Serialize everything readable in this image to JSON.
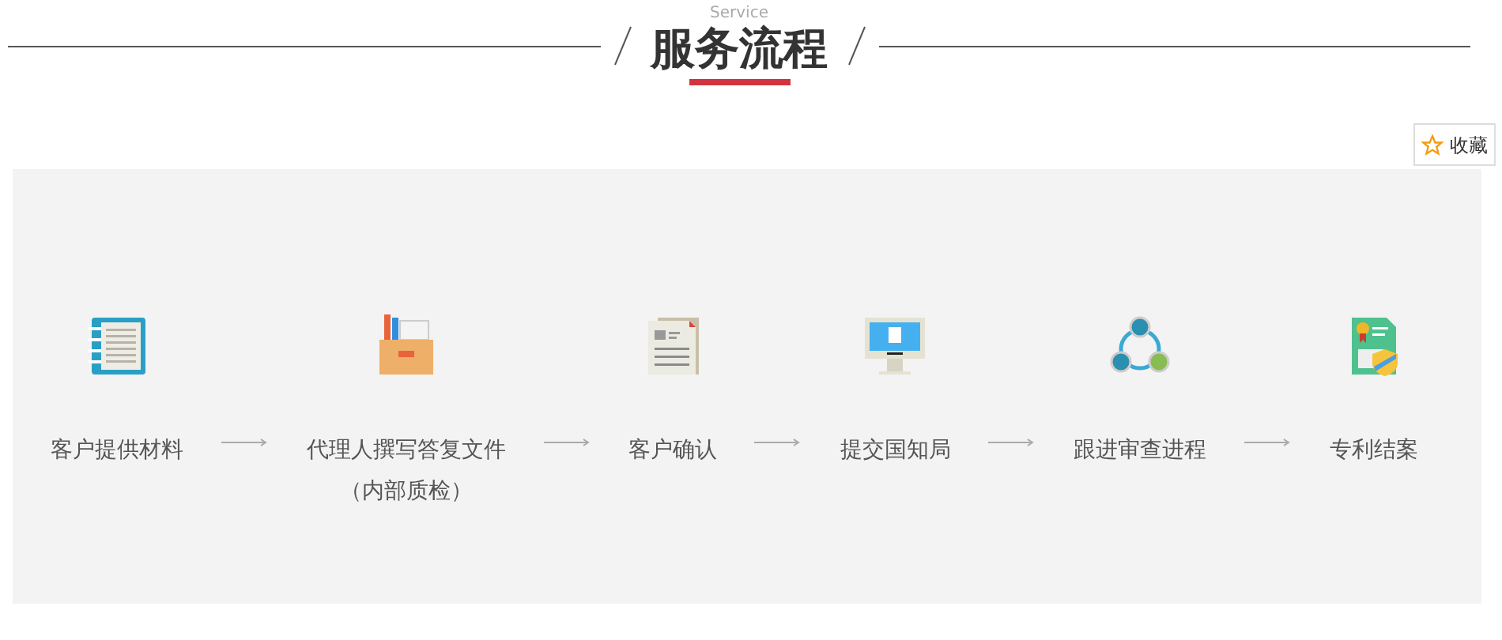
{
  "header": {
    "subtitle": "Service",
    "title": "服务流程"
  },
  "favorite_button": {
    "label": "收藏"
  },
  "steps": [
    {
      "kind": "notebook",
      "label": "客户提供材料"
    },
    {
      "kind": "folder",
      "label": "代理人撰写答复文件",
      "note": "（内部质检）"
    },
    {
      "kind": "document",
      "label": "客户确认"
    },
    {
      "kind": "monitor",
      "label": "提交国知局"
    },
    {
      "kind": "cycle",
      "label": "跟进审查进程"
    },
    {
      "kind": "certificate",
      "label": "专利结案"
    }
  ]
}
